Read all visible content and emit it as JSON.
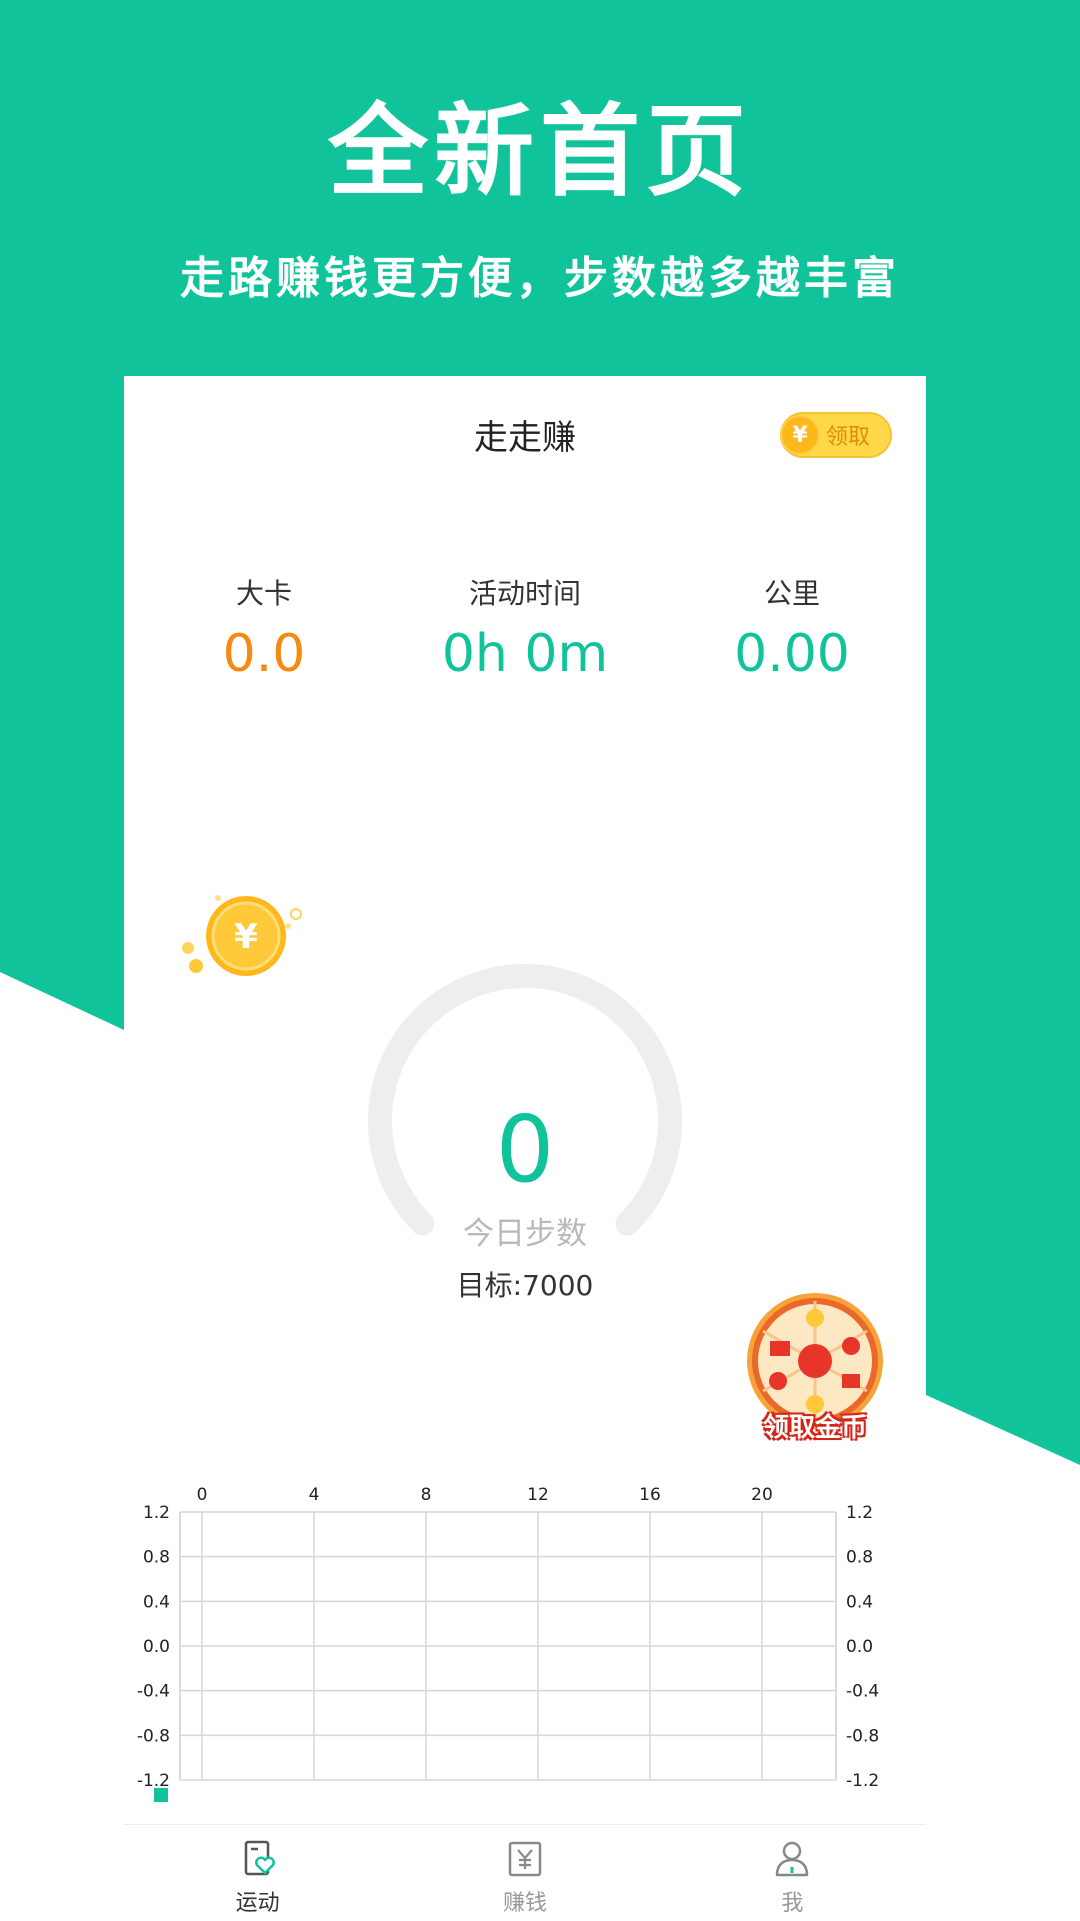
{
  "promo": {
    "title": "全新首页",
    "subtitle": "走路赚钱更方便，步数越多越丰富"
  },
  "colors": {
    "brand_green": "#11c39a",
    "calorie_orange": "#f58a13",
    "gauge_track": "#eeeeee",
    "tab_active_icon": "#11c39a"
  },
  "header": {
    "title": "走走赚",
    "claim_icon": "yuan-coin-icon",
    "claim_symbol": "¥",
    "claim_label": "领取"
  },
  "stats": [
    {
      "label": "大卡",
      "value": "0.0"
    },
    {
      "label": "活动时间",
      "value": "0h 0m"
    },
    {
      "label": "公里",
      "value": "0.00"
    }
  ],
  "steps": {
    "count": "0",
    "label": "今日步数",
    "goal": "目标:7000",
    "progress_fraction": 0
  },
  "float_coin": {
    "icon": "gold-coin-icon",
    "symbol": "¥"
  },
  "wheel": {
    "icon": "prize-wheel-icon",
    "label": "领取金币"
  },
  "chart_data": {
    "type": "line",
    "x_ticks": [
      "0",
      "4",
      "8",
      "12",
      "16",
      "20"
    ],
    "xlim": [
      0,
      24
    ],
    "y_ticks": [
      "1.2",
      "0.8",
      "0.4",
      "0.0",
      "-0.4",
      "-0.8",
      "-1.2"
    ],
    "ylim": [
      -1.2,
      1.2
    ],
    "grid": true,
    "series": [
      {
        "values": []
      }
    ]
  },
  "tabs": [
    {
      "label": "运动",
      "icon": "phone-heart-icon",
      "active": true
    },
    {
      "label": "赚钱",
      "icon": "yuan-note-icon",
      "active": false
    },
    {
      "label": "我",
      "icon": "user-icon",
      "active": false
    }
  ]
}
